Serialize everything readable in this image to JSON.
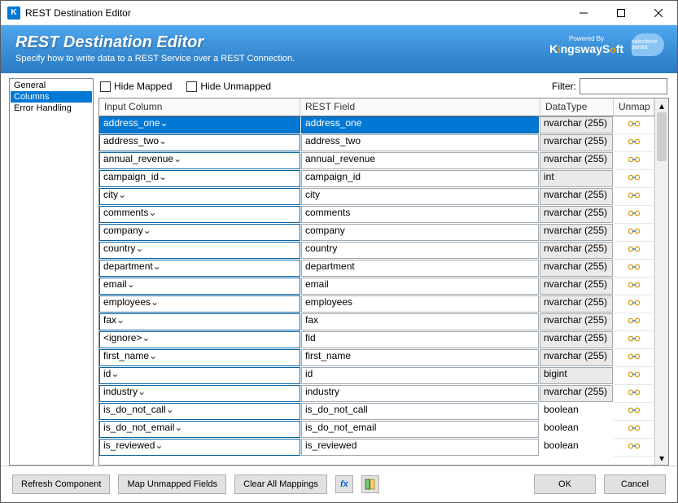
{
  "window": {
    "title": "REST Destination Editor"
  },
  "header": {
    "title": "REST Destination Editor",
    "subtitle": "Specify how to write data to a REST Service over a REST Connection.",
    "powered_by": "Powered By",
    "brand": "KingswaySoft",
    "sf": "salesforce pardot"
  },
  "sidebar": {
    "items": [
      "General",
      "Columns",
      "Error Handling"
    ],
    "selected_index": 1
  },
  "toolbar": {
    "hide_mapped": "Hide Mapped",
    "hide_unmapped": "Hide Unmapped",
    "filter_label": "Filter:"
  },
  "grid": {
    "headers": {
      "input": "Input Column",
      "rest": "REST Field",
      "type": "DataType",
      "unmap": "Unmap"
    },
    "selected_row": 0,
    "rows": [
      {
        "input": "address_one",
        "rest": "address_one",
        "type": "nvarchar (255)",
        "type_boxed": true
      },
      {
        "input": "address_two",
        "rest": "address_two",
        "type": "nvarchar (255)",
        "type_boxed": true
      },
      {
        "input": "annual_revenue",
        "rest": "annual_revenue",
        "type": "nvarchar (255)",
        "type_boxed": true
      },
      {
        "input": "campaign_id",
        "rest": "campaign_id",
        "type": "int",
        "type_boxed": true
      },
      {
        "input": "city",
        "rest": "city",
        "type": "nvarchar (255)",
        "type_boxed": true
      },
      {
        "input": "comments",
        "rest": "comments",
        "type": "nvarchar (255)",
        "type_boxed": true
      },
      {
        "input": "company",
        "rest": "company",
        "type": "nvarchar (255)",
        "type_boxed": true
      },
      {
        "input": "country",
        "rest": "country",
        "type": "nvarchar (255)",
        "type_boxed": true
      },
      {
        "input": "department",
        "rest": "department",
        "type": "nvarchar (255)",
        "type_boxed": true
      },
      {
        "input": "email",
        "rest": "email",
        "type": "nvarchar (255)",
        "type_boxed": true
      },
      {
        "input": "employees",
        "rest": "employees",
        "type": "nvarchar (255)",
        "type_boxed": true
      },
      {
        "input": "fax",
        "rest": "fax",
        "type": "nvarchar (255)",
        "type_boxed": true
      },
      {
        "input": "<ignore>",
        "rest": "fid",
        "type": "nvarchar (255)",
        "type_boxed": true
      },
      {
        "input": "first_name",
        "rest": "first_name",
        "type": "nvarchar (255)",
        "type_boxed": true
      },
      {
        "input": "id",
        "rest": "id",
        "type": "bigint",
        "type_boxed": true
      },
      {
        "input": "industry",
        "rest": "industry",
        "type": "nvarchar (255)",
        "type_boxed": true
      },
      {
        "input": "is_do_not_call",
        "rest": "is_do_not_call",
        "type": "boolean",
        "type_boxed": false
      },
      {
        "input": "is_do_not_email",
        "rest": "is_do_not_email",
        "type": "boolean",
        "type_boxed": false
      },
      {
        "input": "is_reviewed",
        "rest": "is_reviewed",
        "type": "boolean",
        "type_boxed": false
      }
    ]
  },
  "footer": {
    "refresh": "Refresh Component",
    "map_unmapped": "Map Unmapped Fields",
    "clear_all": "Clear All Mappings",
    "ok": "OK",
    "cancel": "Cancel"
  }
}
